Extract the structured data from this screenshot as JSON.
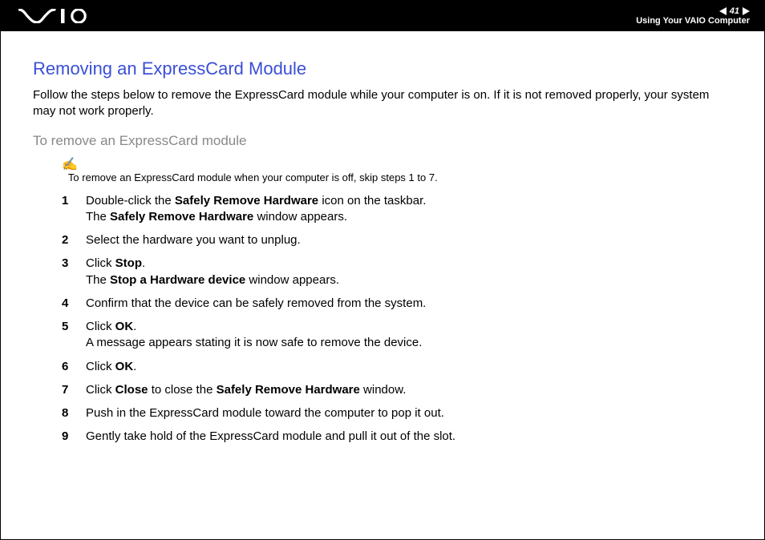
{
  "header": {
    "page_number": "41",
    "section": "Using Your VAIO Computer"
  },
  "content": {
    "heading": "Removing an ExpressCard Module",
    "intro": "Follow the steps below to remove the ExpressCard module while your computer is on. If it is not removed properly, your system may not work properly.",
    "sub_heading": "To remove an ExpressCard module",
    "note": "To remove an ExpressCard module when your computer is off, skip steps 1 to 7.",
    "steps": [
      {
        "n": "1",
        "plain_a": "Double-click the ",
        "bold_a": "Safely Remove Hardware",
        "plain_b": " icon on the taskbar.",
        "line2_a": "The ",
        "line2_bold": "Safely Remove Hardware",
        "line2_b": " window appears."
      },
      {
        "n": "2",
        "plain_a": "Select the hardware you want to unplug."
      },
      {
        "n": "3",
        "plain_a": "Click ",
        "bold_a": "Stop",
        "plain_b": ".",
        "line2_a": "The ",
        "line2_bold": "Stop a Hardware device",
        "line2_b": " window appears."
      },
      {
        "n": "4",
        "plain_a": "Confirm that the device can be safely removed from the system."
      },
      {
        "n": "5",
        "plain_a": "Click ",
        "bold_a": "OK",
        "plain_b": ".",
        "line2_a": "A message appears stating it is now safe to remove the device."
      },
      {
        "n": "6",
        "plain_a": "Click ",
        "bold_a": "OK",
        "plain_b": "."
      },
      {
        "n": "7",
        "plain_a": "Click ",
        "bold_a": "Close",
        "plain_b": " to close the ",
        "bold_b": "Safely Remove Hardware",
        "plain_c": " window."
      },
      {
        "n": "8",
        "plain_a": "Push in the ExpressCard module toward the computer to pop it out."
      },
      {
        "n": "9",
        "plain_a": "Gently take hold of the ExpressCard module and pull it out of the slot."
      }
    ]
  }
}
